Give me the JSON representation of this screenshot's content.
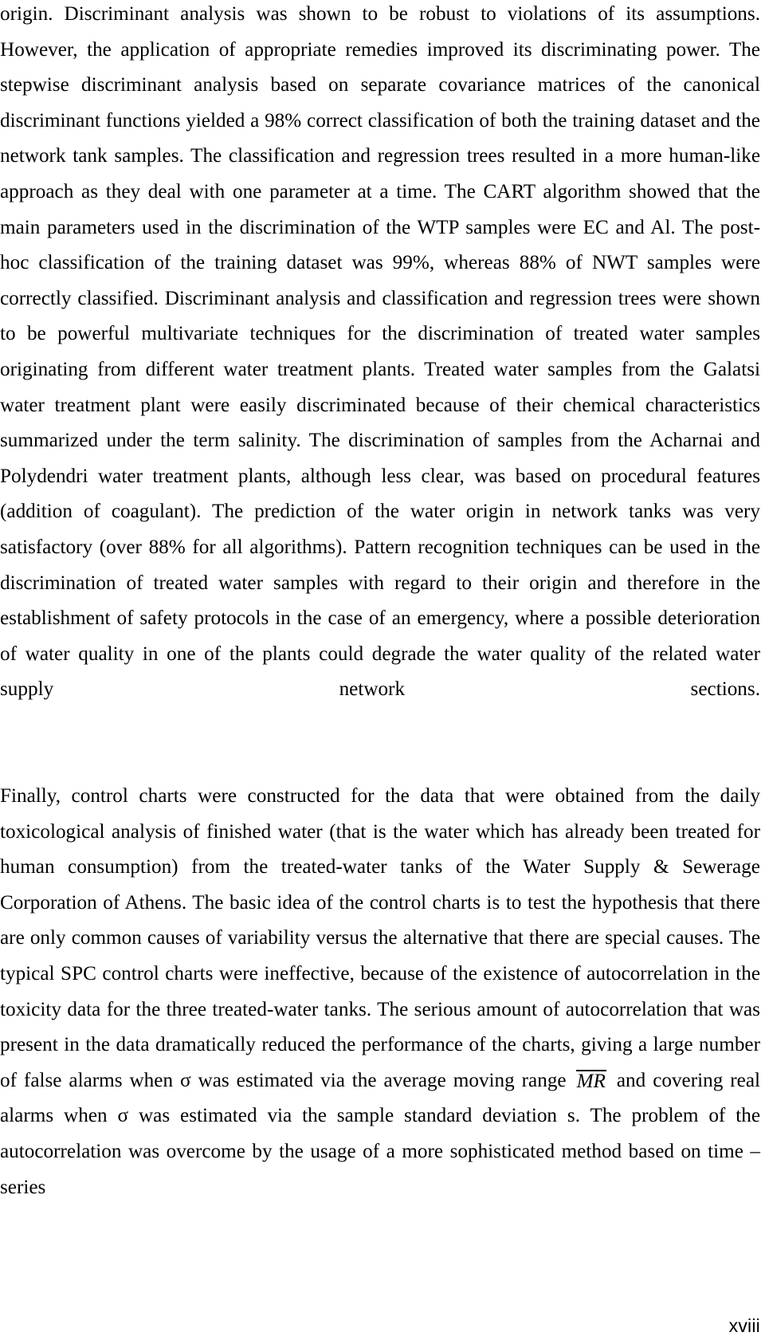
{
  "document": {
    "type": "thesis-page",
    "page_number": "xviii",
    "paragraphs": [
      {
        "id": "paragraph-1",
        "segments": [
          {
            "kind": "text",
            "value": "origin. Discriminant analysis was shown to be robust to violations of its assumptions. However, the application of appropriate remedies improved its discriminating power. The stepwise discriminant analysis based on separate covariance matrices of the canonical discriminant functions yielded a 98% correct classification of both the training dataset and the network tank samples. The classification and regression trees resulted in a more human-like approach as they deal with one parameter at a time. The CART algorithm showed that the main parameters used in the discrimination of the WTP samples were EC and Al. The post-hoc classification of the training dataset was 99%, whereas 88% of NWT samples were correctly classified. Discriminant analysis and classification and regression trees were shown to be powerful multivariate techniques for the discrimination of treated water samples originating from different water treatment plants. Treated water samples from the Galatsi water treatment plant were easily discriminated because of their chemical characteristics summarized under the term salinity. The discrimination of samples from the Acharnai and Polydendri water treatment plants, although less clear, was based on procedural features (addition of coagulant). The prediction of the water origin in network tanks was very satisfactory (over 88% for all algorithms). Pattern recognition techniques can be used in the discrimination of treated water samples with regard to their origin and therefore in the establishment of safety protocols in the case of an emergency, where a possible deterioration of water quality in one of the plants could degrade the water quality of the related water supply network sections."
          }
        ]
      },
      {
        "id": "paragraph-2",
        "segments": [
          {
            "kind": "text",
            "value": "Finally, control charts were constructed for the data that were obtained from the daily toxicological analysis of finished water (that is the water which has already been treated for human consumption) from the treated-water tanks of the Water Supply & Sewerage Corporation of Athens. The basic idea of the control charts is to test the hypothesis that there are only common causes of variability versus the alternative that there are special causes. The typical SPC control charts were ineffective, because of the existence of autocorrelation in the toxicity data for the three treated-water tanks. The serious amount of autocorrelation that was present in the data dramatically reduced the performance of the charts, giving a large number of false alarms when σ was estimated via the average moving range "
          },
          {
            "kind": "overline-italic",
            "value": "MR"
          },
          {
            "kind": "text",
            "value": " and covering real alarms when σ was estimated via the sample standard deviation s. The problem of the autocorrelation was overcome by the usage of a more sophisticated method based on time – series"
          }
        ]
      }
    ]
  }
}
